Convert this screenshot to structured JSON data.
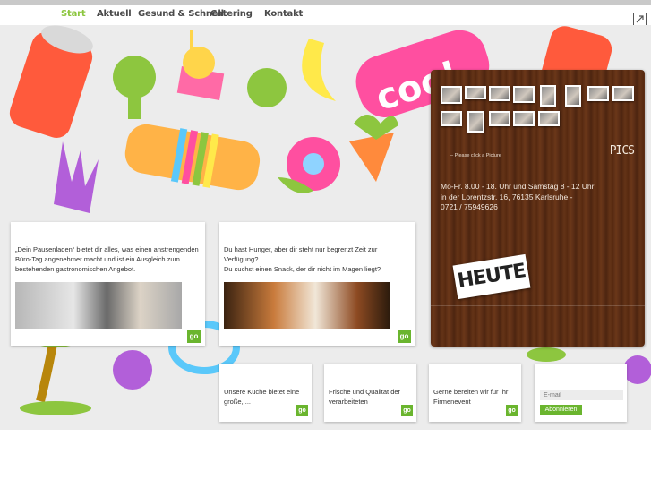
{
  "nav": {
    "items": [
      "Start",
      "Aktuell",
      "Gesund & Schnell",
      "Catering",
      "Kontakt"
    ],
    "active_color": "#8cc63f"
  },
  "cards": {
    "laden": {
      "text": "„Dein Pausenladen“ bietet dir alles, was einen anstrengenden Büro-Tag angenehmer macht und ist ein Ausgleich zum bestehenden gastronomischen Angebot.",
      "go": "go"
    },
    "hunger": {
      "text": "Du hast Hunger, aber dir steht nur begrenzt Zeit zur Verfügung?\nDu suchst einen Snack, der dir nicht im Magen liegt?",
      "go": "go"
    },
    "kueche": {
      "text": "Unsere Küche bietet eine große, ...",
      "go": "go"
    },
    "frische": {
      "text": "Frische und Qualität der verarbeiteten",
      "go": "go"
    },
    "firmenevent": {
      "text": "Gerne bereiten wir für Ihr Firmenevent",
      "go": "go"
    }
  },
  "panel": {
    "hint": "– Please click a Picture",
    "pics_label": "PICS",
    "hours_line1": "Mo-Fr. 8.00 - 18. Uhr und Samstag 8 - 12 Uhr",
    "hours_line2": "in der Lorentzstr. 16, 76135 Karlsruhe -",
    "hours_line3": "0721 / 75949626",
    "heute": "HEUTE"
  },
  "newsletter": {
    "email_placeholder": "E-mail",
    "button": "Abonnieren"
  },
  "colors": {
    "brand_green": "#6ab52e",
    "wood": "#5a2c14"
  }
}
